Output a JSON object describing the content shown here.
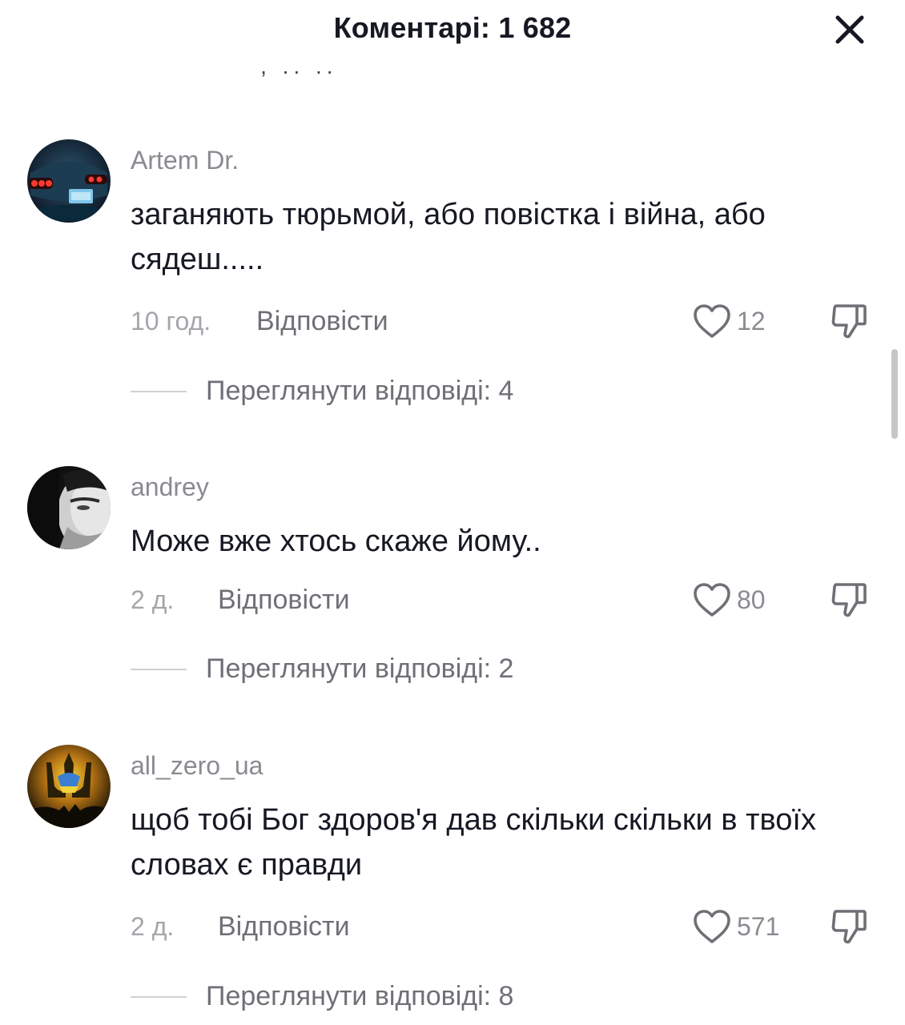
{
  "header": {
    "title": "Коментарі: 1 682",
    "close_icon": "close-icon"
  },
  "comments": [
    {
      "username": "Artem Dr.",
      "text": "заганяють тюрьмой, або повістка і війна, або сядеш.....",
      "time": "10 год.",
      "reply_label": "Відповісти",
      "likes": "12",
      "view_replies": "Переглянути відповіді: 4",
      "avatar_icon": "car-rear-lights-avatar"
    },
    {
      "username": "andrey",
      "text": "Може вже хтось скаже йому..",
      "time": "2 д.",
      "reply_label": "Відповісти",
      "likes": "80",
      "view_replies": "Переглянути відповіді: 2",
      "avatar_icon": "face-avatar"
    },
    {
      "username": "all_zero_ua",
      "text": "щоб тобі Бог здоров'я дав скільки скільки в твоїх словах є правди",
      "time": "2 д.",
      "reply_label": "Відповісти",
      "likes": "571",
      "view_replies": "Переглянути відповіді: 8",
      "avatar_icon": "trident-avatar"
    }
  ],
  "colors": {
    "text_primary": "#161823",
    "text_secondary": "#8a8b91",
    "divider": "#d0d1d3"
  }
}
